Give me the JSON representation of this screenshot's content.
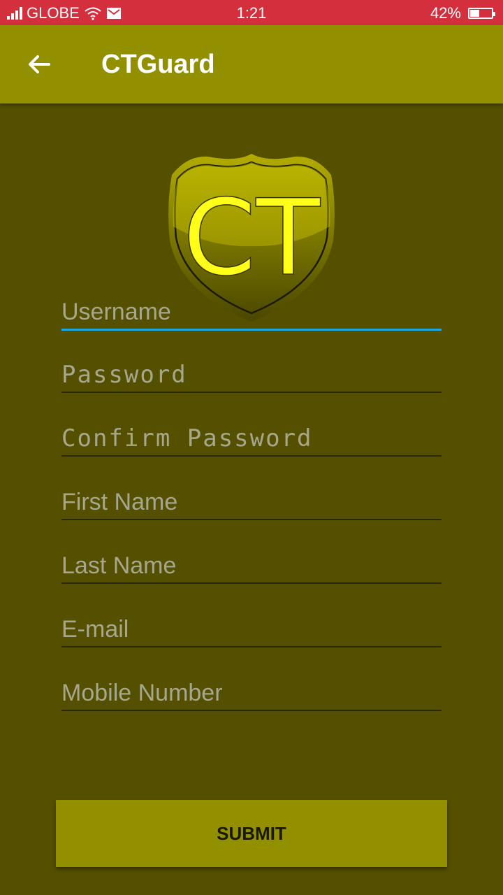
{
  "status_bar": {
    "carrier": "GLOBE",
    "time": "1:21",
    "battery": "42%",
    "battery_level": 0.42
  },
  "app_bar": {
    "title": "CTGuard"
  },
  "logo": {
    "text": "CT"
  },
  "form": {
    "username_placeholder": "Username",
    "password_placeholder": "Password",
    "confirm_password_placeholder": "Confirm Password",
    "first_name_placeholder": "First Name",
    "last_name_placeholder": "Last Name",
    "email_placeholder": "E-mail",
    "mobile_placeholder": "Mobile Number"
  },
  "submit_label": "SUBMIT",
  "colors": {
    "status_bar": "#d32f3c",
    "app_bar": "#939000",
    "background": "#545000",
    "focus_underline": "#1fa5e0",
    "logo_text": "#ffff1a"
  }
}
